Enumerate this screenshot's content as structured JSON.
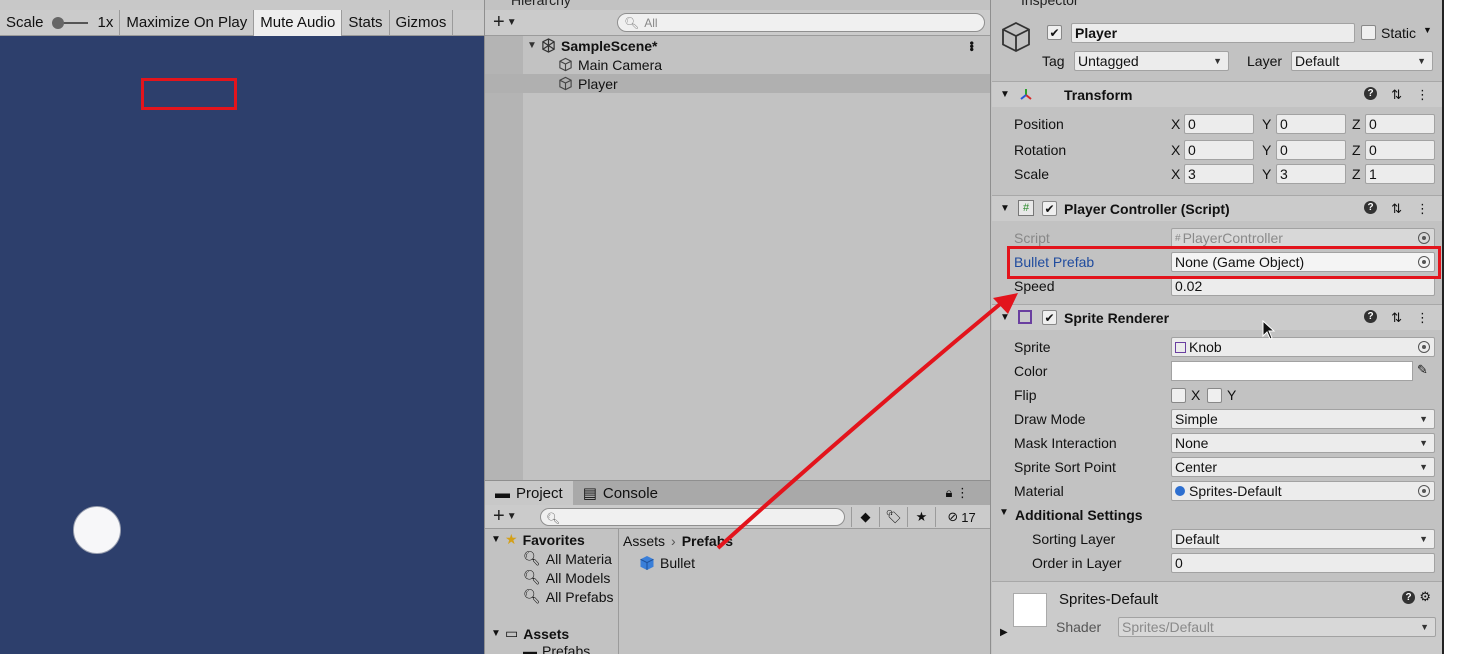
{
  "game": {
    "scale_label": "Scale",
    "scale_value": "1x",
    "maximize_label": "Maximize On Play",
    "mute_label": "Mute Audio",
    "stats_label": "Stats",
    "gizmos_label": "Gizmos",
    "background_color": "#2d3f6c"
  },
  "hierarchy": {
    "tab_label": "Hierarchy",
    "search_placeholder": "All",
    "items": [
      {
        "label": "SampleScene*"
      },
      {
        "label": "Main Camera"
      },
      {
        "label": "Player"
      }
    ]
  },
  "project": {
    "tabs": [
      {
        "label": "Project"
      },
      {
        "label": "Console"
      }
    ],
    "hidden_count": "17",
    "tree": [
      {
        "label": "Favorites"
      },
      {
        "label": "All Materia"
      },
      {
        "label": "All Models"
      },
      {
        "label": "All Prefabs"
      },
      {
        "label": "Assets"
      },
      {
        "label": "Prefabs"
      }
    ],
    "breadcrumb": [
      "Assets",
      "Prefabs"
    ],
    "assets": [
      {
        "label": "Bullet"
      }
    ]
  },
  "inspector": {
    "tab_label": "Inspector",
    "object_name": "Player",
    "static_label": "Static",
    "tag_label": "Tag",
    "tag_value": "Untagged",
    "layer_label": "Layer",
    "layer_value": "Default",
    "transform": {
      "title": "Transform",
      "position_label": "Position",
      "rotation_label": "Rotation",
      "scale_label": "Scale",
      "axes": [
        "X",
        "Y",
        "Z"
      ],
      "position": [
        "0",
        "0",
        "0"
      ],
      "rotation": [
        "0",
        "0",
        "0"
      ],
      "scale": [
        "3",
        "3",
        "1"
      ]
    },
    "player_controller": {
      "title": "Player Controller (Script)",
      "script_label": "Script",
      "script_value": "PlayerController",
      "bullet_label": "Bullet Prefab",
      "bullet_value": "None (Game Object)",
      "speed_label": "Speed",
      "speed_value": "0.02"
    },
    "sprite_renderer": {
      "title": "Sprite Renderer",
      "sprite_label": "Sprite",
      "sprite_value": "Knob",
      "color_label": "Color",
      "flip_label": "Flip",
      "flip_x": "X",
      "flip_y": "Y",
      "draw_mode_label": "Draw Mode",
      "draw_mode_value": "Simple",
      "mask_label": "Mask Interaction",
      "mask_value": "None",
      "sort_point_label": "Sprite Sort Point",
      "sort_point_value": "Center",
      "material_label": "Material",
      "material_value": "Sprites-Default",
      "additional_label": "Additional Settings",
      "sorting_layer_label": "Sorting Layer",
      "sorting_layer_value": "Default",
      "order_label": "Order in Layer",
      "order_value": "0"
    },
    "material_preview": {
      "name": "Sprites-Default",
      "shader_label": "Shader",
      "shader_value": "Sprites/Default"
    }
  },
  "annotation_color": "#e3141c"
}
